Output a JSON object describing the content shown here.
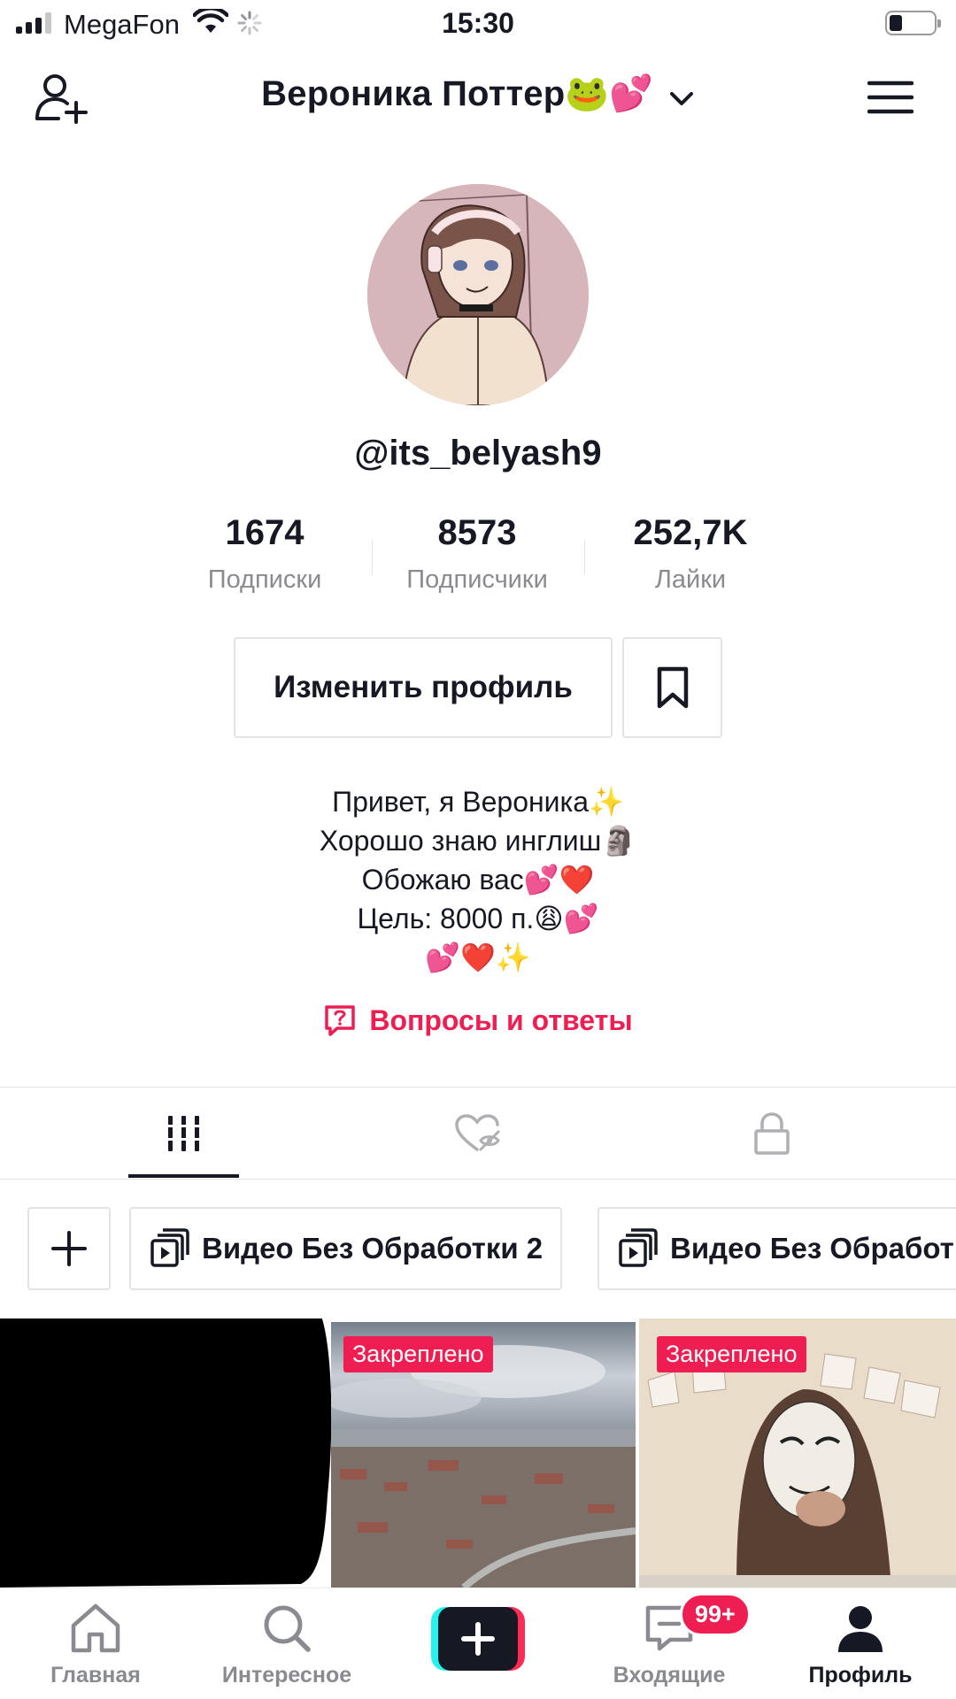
{
  "status_bar": {
    "carrier": "MegaFon",
    "time": "15:30"
  },
  "header": {
    "title": "Вероника Поттер🐸💕"
  },
  "profile": {
    "handle": "@its_belyash9",
    "stats": [
      {
        "value": "1674",
        "label": "Подписки"
      },
      {
        "value": "8573",
        "label": "Подписчики"
      },
      {
        "value": "252,7K",
        "label": "Лайки"
      }
    ],
    "edit_label": "Изменить профиль",
    "bio": [
      "Привет, я Вероника✨",
      "Хорошо знаю инглиш🗿",
      "Обожаю вас💕❤️",
      "Цель: 8000 п.😩💕",
      "💕❤️✨"
    ],
    "qa_label": "Вопросы и ответы"
  },
  "playlists": [
    {
      "label": "Видео Без Обработки 2"
    },
    {
      "label": "Видео Без Обработки"
    }
  ],
  "videos": [
    {
      "pinned": ""
    },
    {
      "pinned": "Закреплено"
    },
    {
      "pinned": "Закреплено"
    }
  ],
  "nav": [
    {
      "label": "Главная",
      "icon": "home-icon"
    },
    {
      "label": "Интересное",
      "icon": "search-icon"
    },
    {
      "label": "",
      "icon": "plus-icon"
    },
    {
      "label": "Входящие",
      "icon": "inbox-icon"
    },
    {
      "label": "Профиль",
      "icon": "profile-icon"
    }
  ],
  "inbox_badge": "99+",
  "colors": {
    "accent": "#ee1d52",
    "text": "#161823",
    "muted": "#8a8b91",
    "border": "#e3e3e4"
  }
}
